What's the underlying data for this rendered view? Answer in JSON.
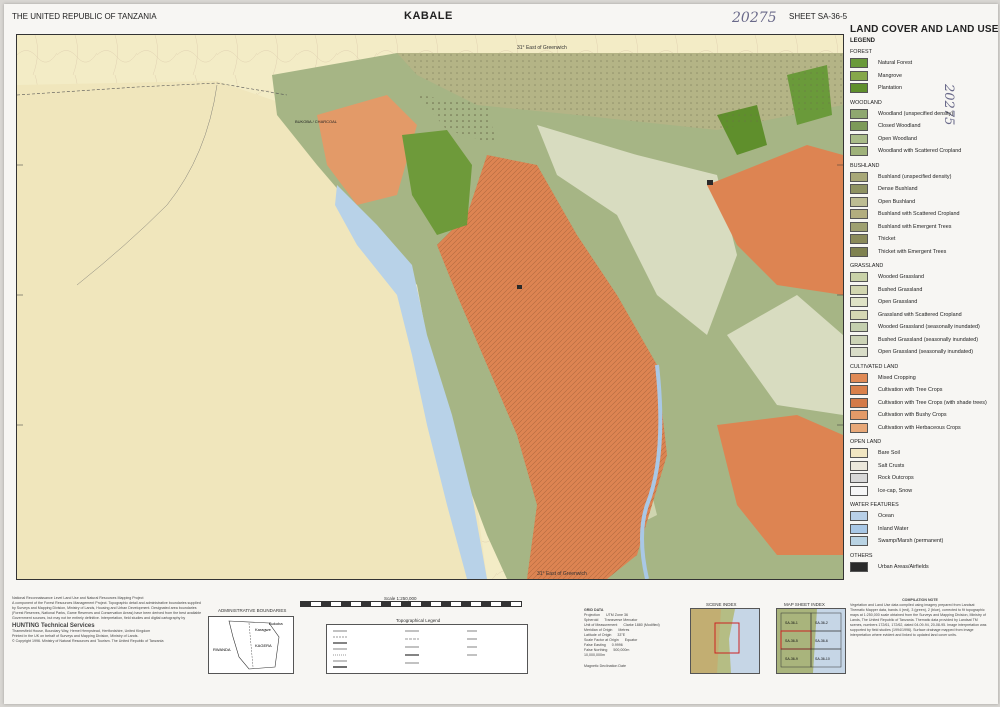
{
  "header": {
    "country": "THE UNITED REPUBLIC OF TANZANIA",
    "title": "KABALE",
    "sheet": "SHEET SA-36-5",
    "handwritten_top": "20275",
    "handwritten_side": "20275"
  },
  "legend": {
    "title": "LAND COVER AND LAND USE",
    "label": "LEGEND",
    "sections": [
      {
        "name": "FOREST",
        "items": [
          {
            "label": "Natural Forest",
            "color": "#6a9a3a"
          },
          {
            "label": "Mangrove",
            "color": "#86a84a"
          },
          {
            "label": "Plantation",
            "color": "#5f8f2c"
          }
        ]
      },
      {
        "name": "WOODLAND",
        "items": [
          {
            "label": "Woodland (unspecified density)",
            "color": "#8fa870"
          },
          {
            "label": "Closed Woodland",
            "color": "#7c9a58"
          },
          {
            "label": "Open Woodland",
            "color": "#a9bb88"
          },
          {
            "label": "Woodland with Scattered Cropland",
            "color": "#9fb27a"
          }
        ]
      },
      {
        "name": "BUSHLAND",
        "items": [
          {
            "label": "Bushland (unspecified density)",
            "color": "#a8a878"
          },
          {
            "label": "Dense Bushland",
            "color": "#8e9262"
          },
          {
            "label": "Open Bushland",
            "color": "#bdbd93"
          },
          {
            "label": "Bushland with Scattered Cropland",
            "color": "#b2ad7e"
          },
          {
            "label": "Bushland with Emergent Trees",
            "color": "#9ea070"
          },
          {
            "label": "Thicket",
            "color": "#8a8a5a"
          },
          {
            "label": "Thicket with Emergent Trees",
            "color": "#7f8250"
          }
        ]
      },
      {
        "name": "GRASSLAND",
        "items": [
          {
            "label": "Wooded Grassland",
            "color": "#c9d2a8"
          },
          {
            "label": "Bushed Grassland",
            "color": "#d2d6b0"
          },
          {
            "label": "Open Grassland",
            "color": "#dfe3c6"
          },
          {
            "label": "Grassland with Scattered Cropland",
            "color": "#d6d8b4"
          },
          {
            "label": "Wooded Grassland (seasonally inundated)",
            "color": "#c4cfae"
          },
          {
            "label": "Bushed Grassland (seasonally inundated)",
            "color": "#ccd3b6"
          },
          {
            "label": "Open Grassland (seasonally inundated)",
            "color": "#d9ddc8"
          }
        ]
      },
      {
        "name": "CULTIVATED LAND",
        "items": [
          {
            "label": "Mixed Cropping",
            "color": "#e08a55"
          },
          {
            "label": "Cultivation with Tree Crops",
            "color": "#d9804a"
          },
          {
            "label": "Cultivation with Tree Crops (with shade trees)",
            "color": "#d47a48"
          },
          {
            "label": "Cultivation with Bushy Crops",
            "color": "#e39a68"
          },
          {
            "label": "Cultivation with Herbaceous Crops",
            "color": "#e8a878"
          }
        ]
      },
      {
        "name": "OPEN LAND",
        "items": [
          {
            "label": "Bare Soil",
            "color": "#f1e6c2"
          },
          {
            "label": "Salt Crusts",
            "color": "#ece8dc"
          },
          {
            "label": "Rock Outcrops",
            "color": "#d8d8d8"
          },
          {
            "label": "Ice-cap, Snow",
            "color": "#f6f6f6"
          }
        ]
      },
      {
        "name": "WATER FEATURES",
        "items": [
          {
            "label": "Ocean",
            "color": "#b8d0e8"
          },
          {
            "label": "Inland Water",
            "color": "#a9c8e6"
          },
          {
            "label": "Swamp/Marsh (permanent)",
            "color": "#b9d3e3"
          }
        ]
      },
      {
        "name": "OTHERS",
        "items": [
          {
            "label": "Urban Areas/Airfields",
            "color": "#2a2a2a"
          }
        ]
      }
    ]
  },
  "map": {
    "top_scale": "31° East of Greenwich",
    "bottom_scale": "31° East of Greenwich",
    "place_label": "BUKOBA / CHARCOAL",
    "colors": {
      "uganda": "#f3ecc6",
      "lake": "#f0e6bc",
      "cultivation": "#dd8452",
      "woodland": "#a6b585",
      "bushland": "#b4b486",
      "grass": "#d8dcc0",
      "forest": "#6e9a3a",
      "water": "#b8d2e8"
    }
  },
  "bottom": {
    "credits_title": "National Reconnaissance Level Land Use and Natural Resources Mapping Project",
    "credits_text": "A component of the Forest Resources Management Project. Topographic detail and administrative boundaries supplied by Surveys and Mapping Division, Ministry of Lands, Housing and Urban Development. Designated area boundaries (Forest Reserves, National Parks, Game Reserves and Conservation Areas) have been derived from the best available Government sources, but may not be entirely definitive. Interpretation, field studies and digital cartography by",
    "company": "HUNTING Technical Services",
    "company_addr": "Thamesfield House, Boundary Way, Hemel Hempstead, Hertfordshire, United Kingdom",
    "print_note": "Printed in the UK on behalf of Surveys and Mapping Division, Ministry of Lands.",
    "copyright": "© Copyright 1996. Ministry of Natural Resources and Tourism. The United Republic of Tanzania",
    "admin_title": "ADMINISTRATIVE BOUNDARIES",
    "admin_labels": [
      "RWANDA",
      "Karagwe",
      "KAGERA",
      "Bukoba"
    ],
    "topo_title": "Topographical Legend",
    "grid_title": "GRID DATA",
    "grid_rows": [
      "Projection",
      "Spheroid",
      "Unit of Measurement",
      "Meridian of Origin",
      "Latitude of Origin",
      "Scale Factor at Origin",
      "False Easting",
      "False Northing"
    ],
    "grid_values": [
      "UTM Zone 36",
      "Transverse Mercator",
      "Clarke 1880 (Modified)",
      "Metres",
      "33°E",
      "Equator",
      "0.9996",
      "500,000m",
      "10,000,000m"
    ],
    "magnetic_note": "Magnetic Declination Date",
    "scene_index": "SCENE INDEX",
    "map_sheet_index": "MAP SHEET INDEX",
    "sheet_cells": [
      "SA-36-1",
      "SA-36-2",
      "SA-36-5",
      "SA-36-6",
      "SA-36-9",
      "SA-36-10"
    ],
    "compilation_title": "COMPILATION NOTE",
    "compilation_text": "Vegetation and Land Use data compiled using imagery prepared from Landsat Thematic Mapper data, bands 4 (red), 3 (green), 2 (blue), corrected to fit topographic maps at 1:250,000 scale obtained from the Surveys and Mapping Division, Ministry of Lands, The United Republic of Tanzania. Thematic data provided by Landsat TM scenes, numbers 172/61, 172/62, dated 04-09-94, 20-08-95. Image interpretation was supported by field studies (1994/1996). Surface drainage mapped from image interpretation where evident and linked to updated land cover units.",
    "scale_label": "Scale 1:250,000"
  }
}
